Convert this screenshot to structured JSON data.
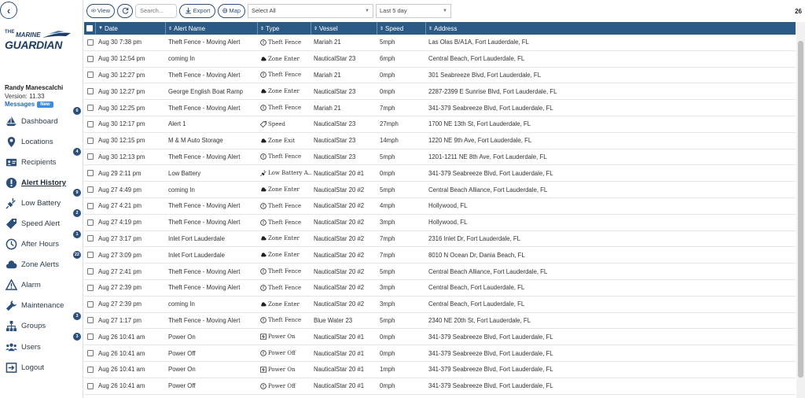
{
  "app": {
    "logo_small": "THE",
    "logo_marine": "MARINE",
    "logo_guardian": "GUARDIAN"
  },
  "user": {
    "name": "Randy Manescalchi",
    "version": "Version: 11.33",
    "messages_label": "Messages",
    "new_badge": "New"
  },
  "sidebar": {
    "items": [
      {
        "label": "Dashboard",
        "icon": "boat-icon",
        "badge": "6"
      },
      {
        "label": "Locations",
        "icon": "map-pin-icon",
        "badge": ""
      },
      {
        "label": "Recipients",
        "icon": "contact-card-icon",
        "badge": "4"
      },
      {
        "label": "Alert History",
        "icon": "exclamation-circle-icon",
        "badge": "",
        "active": true
      },
      {
        "label": "Low Battery",
        "icon": "plug-icon",
        "badge": "9"
      },
      {
        "label": "Speed Alert",
        "icon": "speed-tag-icon",
        "badge": "2"
      },
      {
        "label": "After Hours",
        "icon": "clock-icon",
        "badge": "1"
      },
      {
        "label": "Zone Alerts",
        "icon": "cloud-icon",
        "badge": "22"
      },
      {
        "label": "Alarm",
        "icon": "warning-triangle-icon",
        "badge": ""
      },
      {
        "label": "Maintenance",
        "icon": "wrench-icon",
        "badge": ""
      },
      {
        "label": "Groups",
        "icon": "sitemap-icon",
        "badge": "3"
      },
      {
        "label": "Users",
        "icon": "users-icon",
        "badge": "3"
      },
      {
        "label": "Logout",
        "icon": "logout-icon",
        "badge": ""
      }
    ]
  },
  "toolbar": {
    "view_label": "View",
    "refresh_icon": "refresh-icon",
    "search_placeholder": "Search...",
    "export_label": "Export",
    "map_label": "Map",
    "vessel_select": "Select All",
    "range_select": "Last 5 day",
    "total_count": "26"
  },
  "table": {
    "headers": [
      "Date",
      "Alert Name",
      "Type",
      "Vessel",
      "Speed",
      "Address"
    ],
    "rows": [
      {
        "date": "Aug 30 7:38 pm",
        "name": "Theft Fence - Moving Alert",
        "type": "Theft Fence",
        "type_icon": "exclamation-icon",
        "vessel": "Mariah 21",
        "speed": "5mph",
        "address": "Las Olas B/A1A, Fort Lauderdale, FL"
      },
      {
        "date": "Aug 30 12:54 pm",
        "name": "coming In",
        "type": "Zone Enter",
        "type_icon": "cloud-icon",
        "vessel": "NauticalStar 23",
        "speed": "6mph",
        "address": "Central Beach, Fort Lauderdale, FL"
      },
      {
        "date": "Aug 30 12:27 pm",
        "name": "Theft Fence - Moving Alert",
        "type": "Theft Fence",
        "type_icon": "exclamation-icon",
        "vessel": "Mariah 21",
        "speed": "0mph",
        "address": "301 Seabreeze Blvd, Fort Lauderdale, FL"
      },
      {
        "date": "Aug 30 12:27 pm",
        "name": "George English Boat Ramp",
        "type": "Zone Enter",
        "type_icon": "cloud-icon",
        "vessel": "NauticalStar 23",
        "speed": "0mph",
        "address": "2287-2399 E Sunrise Blvd, Fort Lauderdale, FL"
      },
      {
        "date": "Aug 30 12:25 pm",
        "name": "Theft Fence - Moving Alert",
        "type": "Theft Fence",
        "type_icon": "exclamation-icon",
        "vessel": "Mariah 21",
        "speed": "7mph",
        "address": "341-379 Seabreeze Blvd, Fort Lauderdale, FL"
      },
      {
        "date": "Aug 30 12:17 pm",
        "name": "Alert 1",
        "type": "Speed",
        "type_icon": "speed-tag-icon",
        "vessel": "NauticalStar 23",
        "speed": "27mph",
        "address": "1700 NE 13th St, Fort Lauderdale, FL"
      },
      {
        "date": "Aug 30 12:15 pm",
        "name": "M & M Auto Storage",
        "type": "Zone Exit",
        "type_icon": "cloud-icon",
        "vessel": "NauticalStar 23",
        "speed": "14mph",
        "address": "1220 NE 9th Ave, Fort Lauderdale, FL"
      },
      {
        "date": "Aug 30 12:13 pm",
        "name": "Theft Fence - Moving Alert",
        "type": "Theft Fence",
        "type_icon": "exclamation-icon",
        "vessel": "NauticalStar 23",
        "speed": "5mph",
        "address": "1201-1211 NE 8th Ave, Fort Lauderdale, FL"
      },
      {
        "date": "Aug 29 2:11 pm",
        "name": "Low Battery",
        "type": "Low Battery A...",
        "type_icon": "plug-icon",
        "vessel": "NauticalStar 20 #1",
        "speed": "0mph",
        "address": "341-379 Seabreeze Blvd, Fort Lauderdale, FL"
      },
      {
        "date": "Aug 27 4:49 pm",
        "name": "coming In",
        "type": "Zone Enter",
        "type_icon": "cloud-icon",
        "vessel": "NauticalStar 20 #2",
        "speed": "5mph",
        "address": "Central Beach Alliance, Fort Lauderdale, FL"
      },
      {
        "date": "Aug 27 4:21 pm",
        "name": "Theft Fence - Moving Alert",
        "type": "Theft Fence",
        "type_icon": "exclamation-icon",
        "vessel": "NauticalStar 20 #2",
        "speed": "4mph",
        "address": "Hollywood, FL"
      },
      {
        "date": "Aug 27 4:19 pm",
        "name": "Theft Fence - Moving Alert",
        "type": "Theft Fence",
        "type_icon": "exclamation-icon",
        "vessel": "NauticalStar 20 #2",
        "speed": "3mph",
        "address": "Hollywood, FL"
      },
      {
        "date": "Aug 27 3:17 pm",
        "name": "Inlet Fort Lauderdale",
        "type": "Zone Enter",
        "type_icon": "cloud-icon",
        "vessel": "NauticalStar 20 #2",
        "speed": "7mph",
        "address": "2316 Inlet Dr, Fort Lauderdale, FL"
      },
      {
        "date": "Aug 27 3:09 pm",
        "name": "Inlet Fort Lauderdale",
        "type": "Zone Enter",
        "type_icon": "cloud-icon",
        "vessel": "NauticalStar 20 #2",
        "speed": "7mph",
        "address": "8010 N Ocean Dr, Dania Beach, FL"
      },
      {
        "date": "Aug 27 2:41 pm",
        "name": "Theft Fence - Moving Alert",
        "type": "Theft Fence",
        "type_icon": "exclamation-icon",
        "vessel": "NauticalStar 20 #2",
        "speed": "5mph",
        "address": "Central Beach Alliance, Fort Lauderdale, FL"
      },
      {
        "date": "Aug 27 2:39 pm",
        "name": "Theft Fence - Moving Alert",
        "type": "Theft Fence",
        "type_icon": "exclamation-icon",
        "vessel": "NauticalStar 20 #2",
        "speed": "3mph",
        "address": "Central Beach, Fort Lauderdale, FL"
      },
      {
        "date": "Aug 27 2:39 pm",
        "name": "coming In",
        "type": "Zone Enter",
        "type_icon": "cloud-icon",
        "vessel": "NauticalStar 20 #2",
        "speed": "3mph",
        "address": "Central Beach, Fort Lauderdale, FL"
      },
      {
        "date": "Aug 27 1:17 pm",
        "name": "Theft Fence - Moving Alert",
        "type": "Theft Fence",
        "type_icon": "exclamation-icon",
        "vessel": "Blue Water 23",
        "speed": "5mph",
        "address": "2340 NE 20th St, Fort Lauderdale, FL"
      },
      {
        "date": "Aug 26 10:41 am",
        "name": "Power On",
        "type": "Power On",
        "type_icon": "power-icon",
        "vessel": "NauticalStar 20 #1",
        "speed": "0mph",
        "address": "341-379 Seabreeze Blvd, Fort Lauderdale, FL"
      },
      {
        "date": "Aug 26 10:41 am",
        "name": "Power Off",
        "type": "Power Off",
        "type_icon": "exclamation-icon",
        "vessel": "NauticalStar 20 #1",
        "speed": "0mph",
        "address": "341-379 Seabreeze Blvd, Fort Lauderdale, FL"
      },
      {
        "date": "Aug 26 10:41 am",
        "name": "Power On",
        "type": "Power On",
        "type_icon": "power-icon",
        "vessel": "NauticalStar 20 #1",
        "speed": "1mph",
        "address": "341-379 Seabreeze Blvd, Fort Lauderdale, FL"
      },
      {
        "date": "Aug 26 10:41 am",
        "name": "Power Off",
        "type": "Power Off",
        "type_icon": "exclamation-icon",
        "vessel": "NauticalStar 20 #1",
        "speed": "0mph",
        "address": "341-379 Seabreeze Blvd, Fort Lauderdale, FL"
      }
    ]
  },
  "colors": {
    "header_bg": "#2c5a86",
    "brand": "#1d3c66",
    "accent": "#2b4f7a",
    "badge": "#2b4f7a",
    "new_badge": "#3b8fd9"
  }
}
